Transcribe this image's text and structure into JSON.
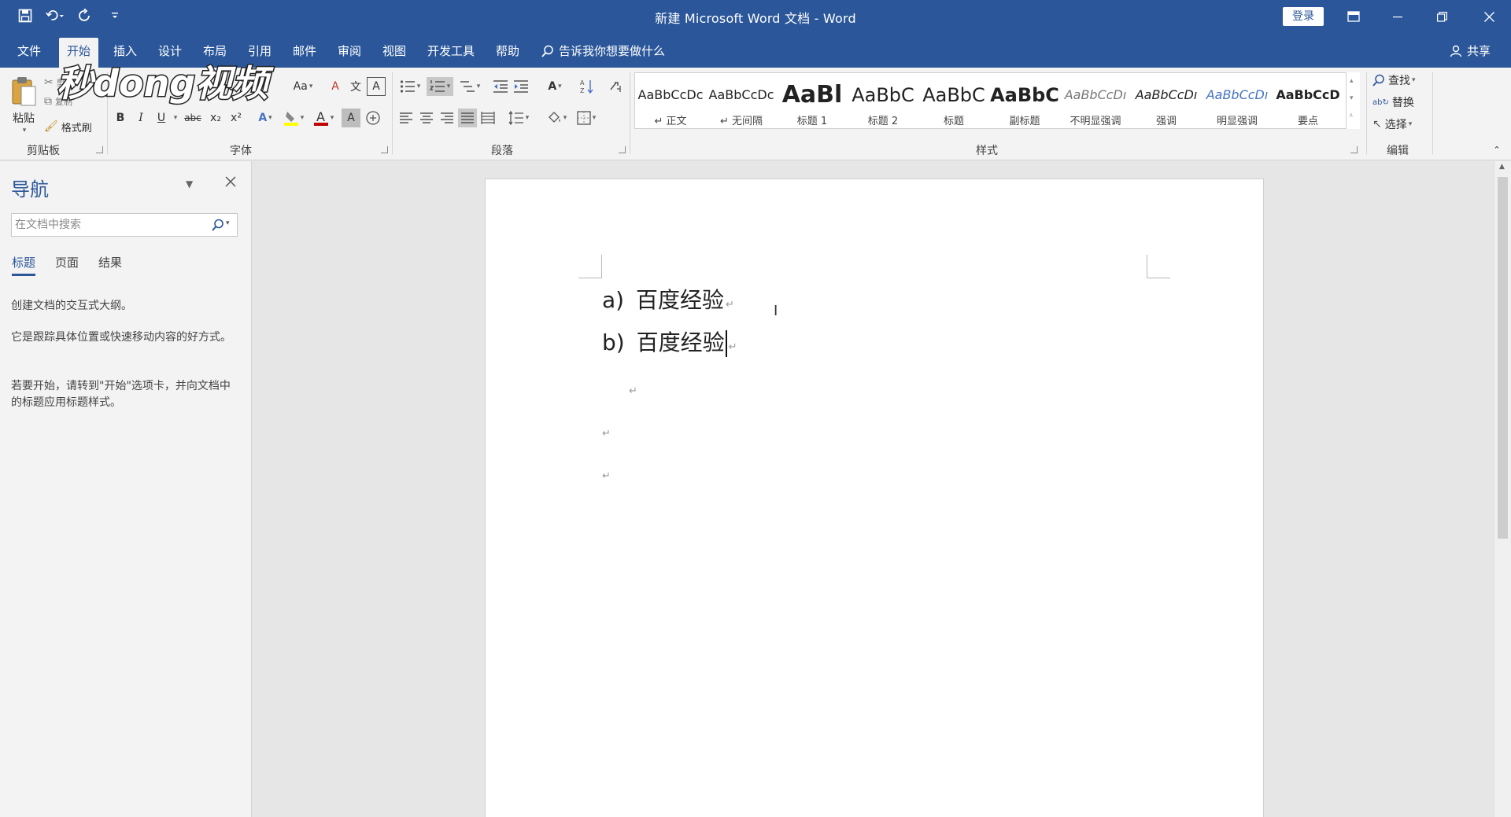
{
  "window": {
    "title": "新建 Microsoft Word 文档 - Word",
    "login_label": "登录"
  },
  "menu": {
    "tabs": [
      "文件",
      "开始",
      "插入",
      "设计",
      "布局",
      "引用",
      "邮件",
      "审阅",
      "视图",
      "开发工具",
      "帮助"
    ],
    "active_tab": "开始",
    "tell_me": "告诉我你想要做什么",
    "share": "共享"
  },
  "ribbon": {
    "clipboard": {
      "paste": "粘贴",
      "cut": "剪切",
      "copy": "复制",
      "format_painter": "格式刷",
      "group": "剪贴板"
    },
    "font": {
      "group": "字体",
      "font_size_btn": "Aa",
      "bold": "B",
      "italic": "I",
      "underline": "U",
      "strikethrough": "abc",
      "subscript": "x₂",
      "superscript": "x²",
      "phonetic": "文",
      "char_border": "A",
      "char_shading": "A",
      "enclose": "字"
    },
    "paragraph": {
      "group": "段落"
    },
    "styles": {
      "group": "样式",
      "items": [
        {
          "sample": "AaBbCcDc",
          "name": "↵ 正文"
        },
        {
          "sample": "AaBbCcDc",
          "name": "↵ 无间隔"
        },
        {
          "sample": "AaBl",
          "name": "标题 1"
        },
        {
          "sample": "AaBbC",
          "name": "标题 2"
        },
        {
          "sample": "AaBbC",
          "name": "标题"
        },
        {
          "sample": "AaBbC",
          "name": "副标题"
        },
        {
          "sample": "AaBbCcDı",
          "name": "不明显强调"
        },
        {
          "sample": "AaBbCcDı",
          "name": "强调"
        },
        {
          "sample": "AaBbCcDı",
          "name": "明显强调"
        },
        {
          "sample": "AaBbCcD",
          "name": "要点"
        }
      ]
    },
    "editing": {
      "group": "编辑",
      "find": "查找",
      "replace": "替换",
      "select": "选择"
    }
  },
  "nav": {
    "title": "导航",
    "search_placeholder": "在文档中搜索",
    "tabs": [
      "标题",
      "页面",
      "结果"
    ],
    "help_lines": [
      "创建文档的交互式大纲。",
      "它是跟踪具体位置或快速移动内容的好方式。",
      "若要开始，请转到\"开始\"选项卡，并向文档中的标题应用标题样式。"
    ]
  },
  "document": {
    "list_items": [
      {
        "marker": "a)",
        "text": "百度经验"
      },
      {
        "marker": "b)",
        "text": "百度经验"
      }
    ],
    "para_mark": "↵"
  },
  "watermark": {
    "text": "秒dong视频"
  },
  "colors": {
    "brand": "#2b579a",
    "ribbon_bg": "#f3f3f3",
    "canvas_bg": "#e6e6e6",
    "font_color_red": "#c00000",
    "highlight_yellow": "#ffff00"
  }
}
